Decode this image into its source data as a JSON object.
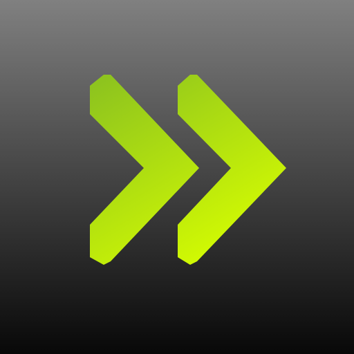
{
  "icon": {
    "name": "fast-forward-icon",
    "background": {
      "top": "#808080",
      "bottom": "#080808"
    },
    "chevron": {
      "light": "#d8ff00",
      "dark": "#8ec41e"
    }
  }
}
